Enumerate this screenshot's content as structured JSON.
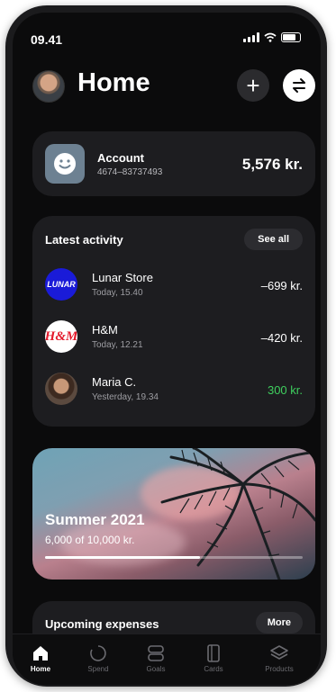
{
  "status_bar": {
    "time": "09.41"
  },
  "header": {
    "title": "Home"
  },
  "account": {
    "name": "Account",
    "number": "4674–83737493",
    "balance": "5,576 kr."
  },
  "activity": {
    "title": "Latest activity",
    "see_all_label": "See all",
    "items": [
      {
        "name": "Lunar Store",
        "time": "Today, 15.40",
        "amount": "–699 kr.",
        "logo_text": "LUNAR"
      },
      {
        "name": "H&M",
        "time": "Today, 12.21",
        "amount": "–420 kr.",
        "logo_text": "H&M"
      },
      {
        "name": "Maria C.",
        "time": "Yesterday, 19.34",
        "amount": "300 kr."
      }
    ]
  },
  "goal": {
    "title": "Summer 2021",
    "progress_text": "6,000 of 10,000 kr.",
    "progress": 0.6
  },
  "upcoming": {
    "title": "Upcoming expenses",
    "more_label": "More"
  },
  "tabs": [
    {
      "label": "Home",
      "icon": "home-icon"
    },
    {
      "label": "Spend",
      "icon": "spend-icon"
    },
    {
      "label": "Goals",
      "icon": "goals-icon"
    },
    {
      "label": "Cards",
      "icon": "cards-icon"
    },
    {
      "label": "Products",
      "icon": "products-icon"
    }
  ],
  "colors": {
    "positive": "#3fcf5e",
    "lunar_blue": "#1a1bd8",
    "hm_red": "#e4192b"
  }
}
